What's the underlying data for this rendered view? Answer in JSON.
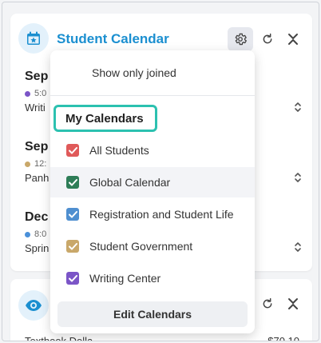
{
  "calendar_card": {
    "title": "Student Calendar",
    "events": [
      {
        "date": "Sep",
        "time": "5:0",
        "name": "Writi",
        "dot_color": "#7b55c7"
      },
      {
        "date": "Sep",
        "time": "12:",
        "name": "Panh",
        "dot_color": "#c9a86a"
      },
      {
        "date": "Dec",
        "time": "8:0",
        "name": "Sprin",
        "dot_color": "#4a90d9"
      }
    ]
  },
  "second_card": {
    "row_label": "Textbook Dolla",
    "row_amount": "$70.10"
  },
  "dropdown": {
    "show_only_joined": "Show only joined",
    "heading": "My Calendars",
    "items": [
      {
        "label": "All Students",
        "color": "#e05a5a",
        "checked": true
      },
      {
        "label": "Global Calendar",
        "color": "#2e7d57",
        "checked": true
      },
      {
        "label": "Registration and Student Life",
        "color": "#4f8fd0",
        "checked": true
      },
      {
        "label": "Student Government",
        "color": "#c9a86a",
        "checked": true
      },
      {
        "label": "Writing Center",
        "color": "#7b55c7",
        "checked": true
      }
    ],
    "footer": "Edit Calendars"
  },
  "icons": {
    "calendar": "calendar-star-icon",
    "gear": "gear-icon",
    "refresh": "refresh-icon",
    "collapse": "collapse-icon",
    "expand": "expand-icon",
    "eye": "eye-icon"
  },
  "colors": {
    "accent": "#1b8fd0",
    "highlight": "#2cc1b0"
  }
}
